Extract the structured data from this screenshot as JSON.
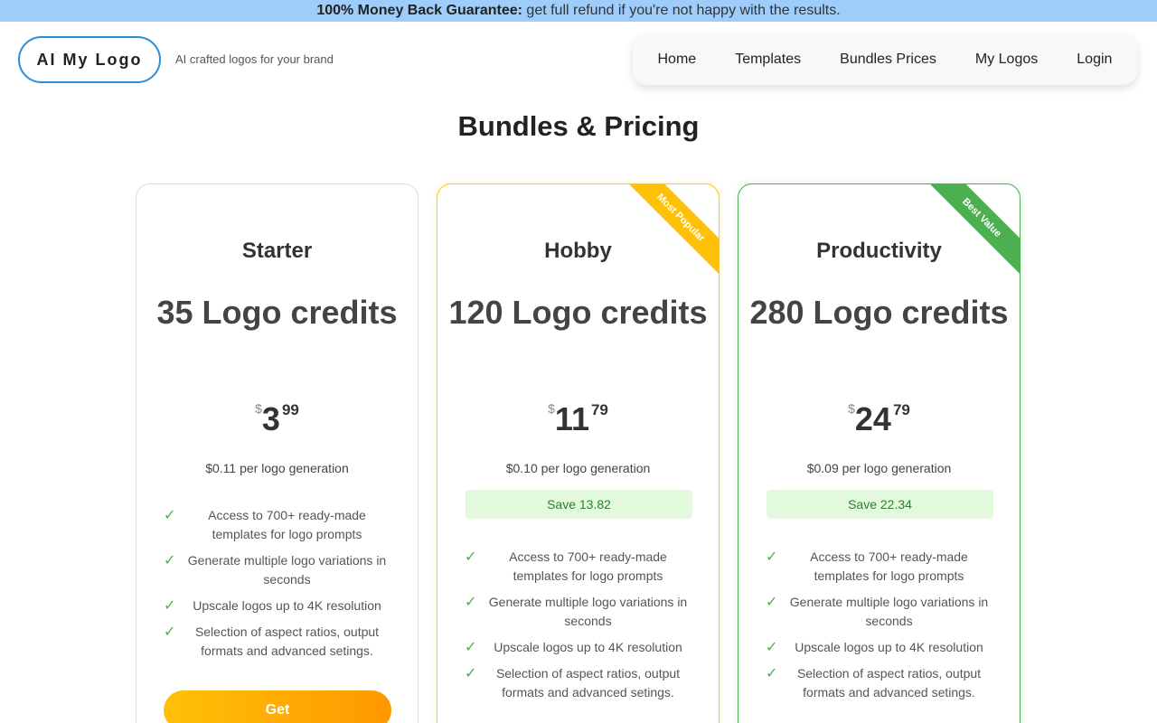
{
  "banner": {
    "bold": "100% Money Back Guarantee:",
    "text": " get full refund if you're not happy with the results."
  },
  "header": {
    "logo": "AI My Logo",
    "tagline": "AI crafted logos for your brand"
  },
  "nav": {
    "items": [
      "Home",
      "Templates",
      "Bundles Prices",
      "My Logos",
      "Login"
    ]
  },
  "page": {
    "title": "Bundles & Pricing"
  },
  "plans": [
    {
      "name": "Starter",
      "credits": "35 Logo credits",
      "currency": "$",
      "price_whole": "3",
      "price_cents": "99",
      "per_generation": "$0.11 per logo generation",
      "ribbon": "",
      "save": "",
      "features": [
        "Access to 700+ ready-made templates for logo prompts",
        "Generate multiple logo variations in seconds",
        "Upscale logos up to 4K resolution",
        "Selection of aspect ratios, output formats and advanced setings."
      ],
      "button": "Get"
    },
    {
      "name": "Hobby",
      "credits": "120 Logo credits",
      "currency": "$",
      "price_whole": "11",
      "price_cents": "79",
      "per_generation": "$0.10 per logo generation",
      "ribbon": "Most Popular",
      "save": "Save 13.82",
      "features": [
        "Access to 700+ ready-made templates for logo prompts",
        "Generate multiple logo variations in seconds",
        "Upscale logos up to 4K resolution",
        "Selection of aspect ratios, output formats and advanced setings."
      ],
      "button": ""
    },
    {
      "name": "Productivity",
      "credits": "280 Logo credits",
      "currency": "$",
      "price_whole": "24",
      "price_cents": "79",
      "per_generation": "$0.09 per logo generation",
      "ribbon": "Best Value",
      "save": "Save 22.34",
      "features": [
        "Access to 700+ ready-made templates for logo prompts",
        "Generate multiple logo variations in seconds",
        "Upscale logos up to 4K resolution",
        "Selection of aspect ratios, output formats and advanced setings."
      ],
      "button": ""
    }
  ],
  "icons": {
    "feature_check": "check-icon"
  },
  "colors": {
    "banner": "#9fcdfb",
    "accent_blue": "#2b8fd6",
    "popular": "#ffc107",
    "best_value": "#4caf50",
    "button_gradient_start": "#ffc107",
    "button_gradient_end": "#ff9800"
  }
}
